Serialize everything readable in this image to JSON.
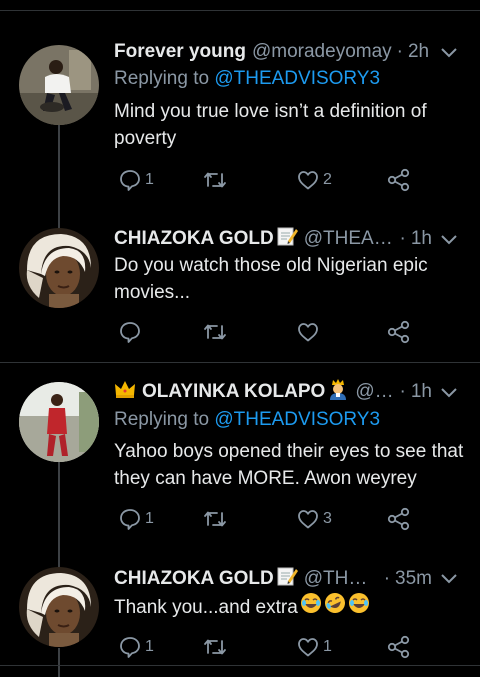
{
  "tweets": [
    {
      "name": "Forever young",
      "handle": "@moradeyomay",
      "time": "2h",
      "replying_label": "Replying to",
      "replying_to": "@THEADVISORY3",
      "text": "Mind you true love isn’t a definition of poverty",
      "replies": "1",
      "retweets": "",
      "likes": "2"
    },
    {
      "name": "CHIAZOKA GOLD",
      "handle": "@THEAD...",
      "time": "1h",
      "text": "Do you watch those old Nigerian epic movies...",
      "replies": "",
      "retweets": "",
      "likes": ""
    },
    {
      "name": "OLAYINKA KOLAPO",
      "handle": "@th...",
      "time": "1h",
      "replying_label": "Replying to",
      "replying_to": "@THEADVISORY3",
      "text": "Yahoo boys opened their eyes to see that they can have MORE. Awon weyrey",
      "replies": "1",
      "retweets": "",
      "likes": "3"
    },
    {
      "name": "CHIAZOKA GOLD",
      "handle": "@THEA...",
      "time": "35m",
      "text": "Thank you...and extra",
      "replies": "1",
      "retweets": "",
      "likes": "1"
    }
  ],
  "separator_dot": "·",
  "colors": {
    "background": "#000000",
    "primary_text": "#e7e9ea",
    "secondary_text": "#8b98a5",
    "mention": "#1d9bf0",
    "divider": "#2f3336"
  },
  "icons": [
    "chevron-down-icon",
    "reply-icon",
    "retweet-icon",
    "like-icon",
    "share-icon",
    "memo-emoji",
    "crown-emoji",
    "man-emoji",
    "laughing-emoji"
  ]
}
